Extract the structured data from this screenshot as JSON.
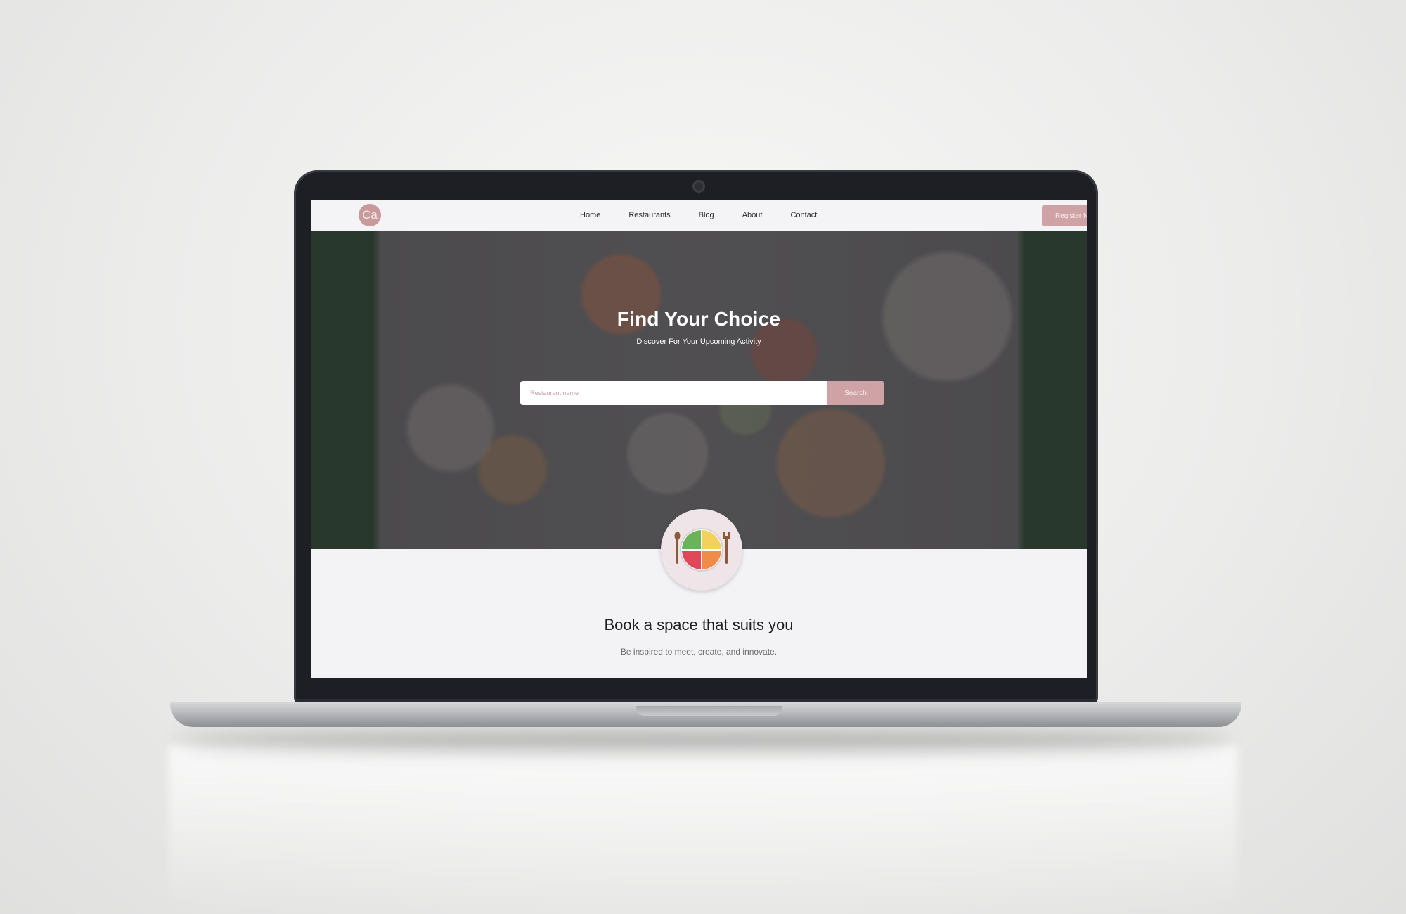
{
  "brand": {
    "logo_text": "Ca",
    "accent_color": "#cfa3a6"
  },
  "nav": {
    "items": [
      {
        "label": "Home"
      },
      {
        "label": "Restaurants"
      },
      {
        "label": "Blog"
      },
      {
        "label": "About"
      },
      {
        "label": "Contact"
      }
    ],
    "cta_label": "Register Now"
  },
  "hero": {
    "title": "Find Your Choice",
    "subtitle": "Discover For Your Upcoming Activity",
    "search": {
      "placeholder": "Restaurant name",
      "value": "",
      "button_label": "Search"
    },
    "badge_icon": "food-plate-icon"
  },
  "section": {
    "title": "Book a space that suits you",
    "subtitle": "Be inspired to meet, create, and innovate."
  }
}
